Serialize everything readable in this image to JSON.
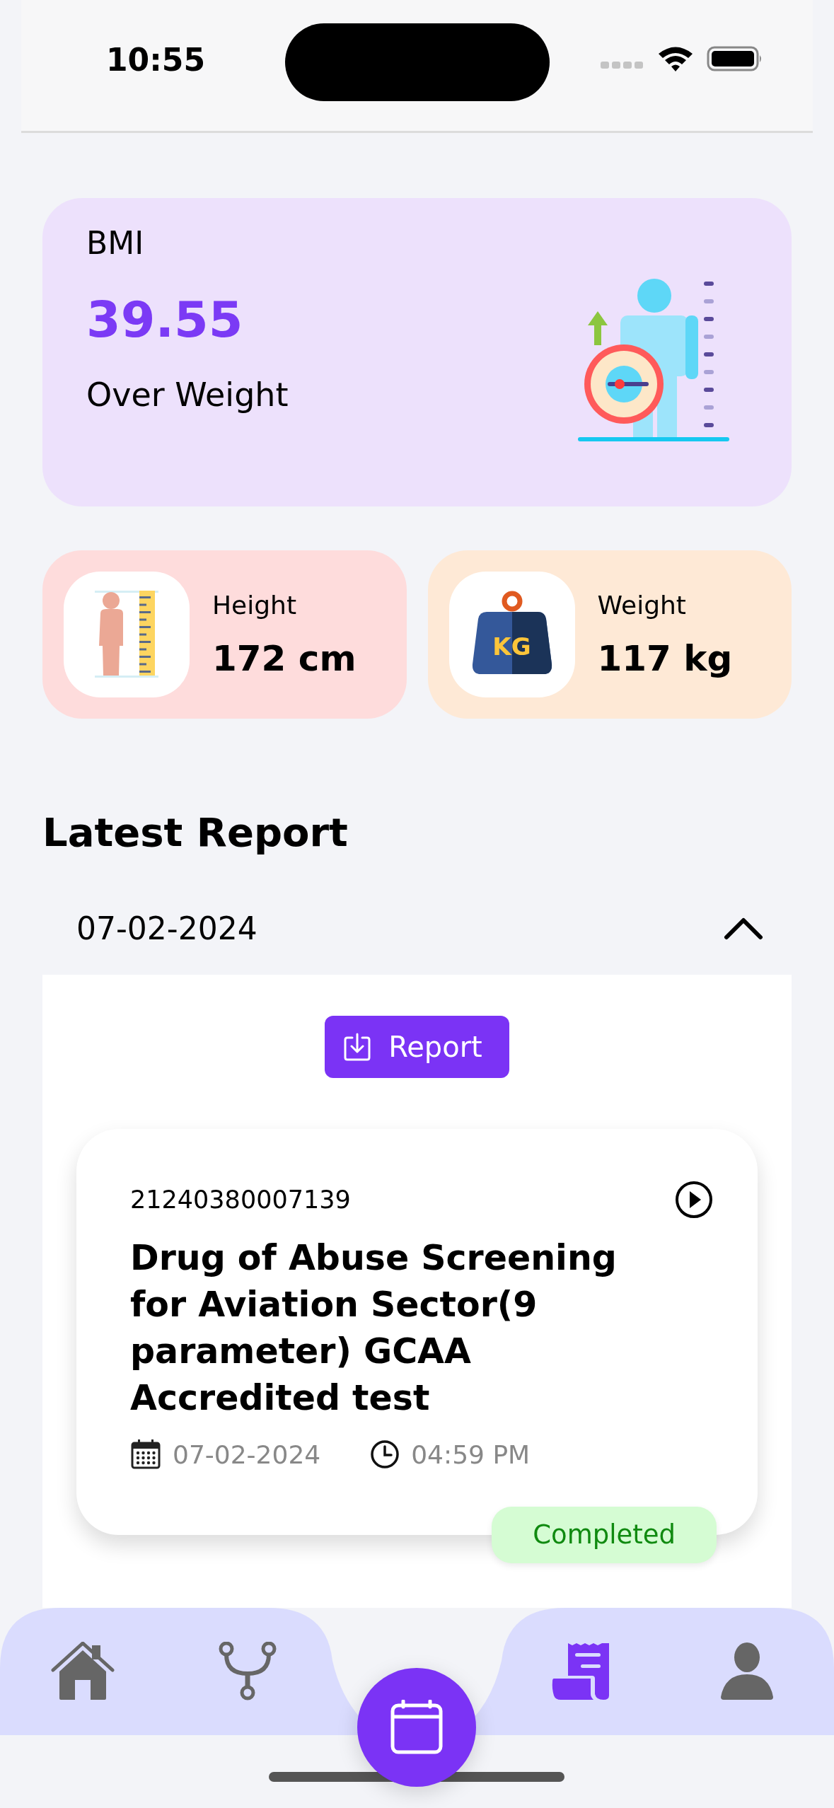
{
  "status_bar": {
    "time": "10:55"
  },
  "bmi": {
    "label": "BMI",
    "value": "39.55",
    "category": "Over Weight"
  },
  "metrics": [
    {
      "kind": "height",
      "label": "Height",
      "value": "172 cm"
    },
    {
      "kind": "weight",
      "label": "Weight",
      "value": "117 kg",
      "icon_label": "KG"
    }
  ],
  "latest_report": {
    "title": "Latest Report",
    "date": "07-02-2024",
    "expanded": true,
    "download_button": "Report",
    "tests": [
      {
        "id": "21240380007139",
        "name": "Drug of Abuse Screening for Aviation Sector(9 parameter) GCAA Accredited test",
        "date": "07-02-2024",
        "time": "04:59 PM",
        "status": "Completed"
      }
    ]
  },
  "bottom_nav": [
    {
      "kind": "home",
      "selected": false
    },
    {
      "kind": "stethoscope",
      "selected": false
    },
    {
      "kind": "calendar",
      "selected": false
    },
    {
      "kind": "reports",
      "selected": true
    },
    {
      "kind": "profile",
      "selected": false
    }
  ]
}
